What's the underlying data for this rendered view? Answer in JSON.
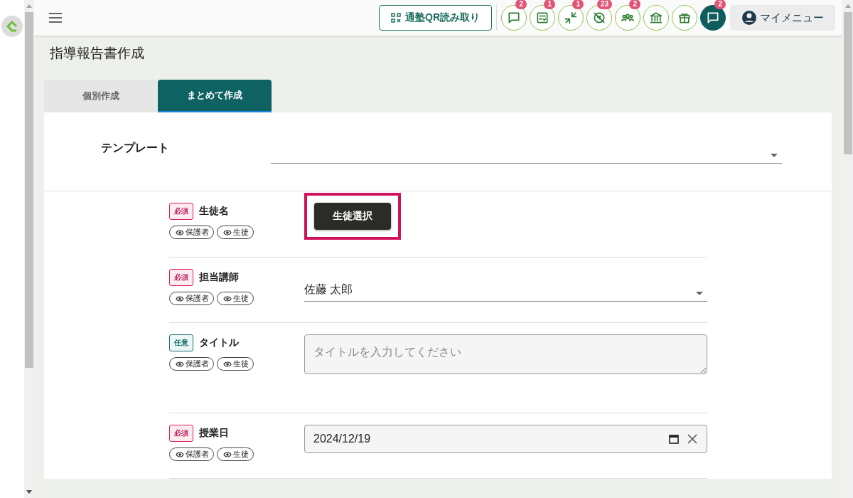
{
  "header": {
    "qr_button": "通塾QR読み取り",
    "icons": [
      {
        "kind": "chat",
        "badge": "2"
      },
      {
        "kind": "checklist",
        "badge": "1"
      },
      {
        "kind": "arrows",
        "badge": "1"
      },
      {
        "kind": "no-location",
        "badge": "23"
      },
      {
        "kind": "group",
        "badge": "2"
      },
      {
        "kind": "bank"
      },
      {
        "kind": "gift"
      },
      {
        "kind": "messages",
        "badge": "2"
      }
    ],
    "my_menu": "マイメニュー"
  },
  "page_title": "指導報告書作成",
  "tabs": [
    {
      "label": "個別作成",
      "selected": false
    },
    {
      "label": "まとめて作成",
      "selected": true
    }
  ],
  "template": {
    "label": "テンプレート"
  },
  "fields": [
    {
      "label": "生徒名",
      "tag": {
        "kind": "required",
        "text": "必須"
      },
      "chips": [
        "保護者",
        "生徒"
      ],
      "kind": "button",
      "button": "生徒選択",
      "highlighted": true
    },
    {
      "label": "担当講師",
      "tag": {
        "kind": "required",
        "text": "必須"
      },
      "chips": [
        "保護者",
        "生徒"
      ],
      "kind": "select",
      "value": "佐藤 太郎",
      "highlighted": false
    },
    {
      "label": "タイトル",
      "tag": {
        "kind": "optional",
        "text": "任意"
      },
      "chips": [
        "保護者",
        "生徒"
      ],
      "kind": "textarea",
      "placeholder": "タイトルを入力してください",
      "highlighted": false
    },
    {
      "label": "授業日",
      "tag": {
        "kind": "required",
        "text": "必須"
      },
      "chips": [
        "保護者",
        "生徒"
      ],
      "kind": "date",
      "value": "2024/12/19",
      "highlighted": false
    }
  ]
}
